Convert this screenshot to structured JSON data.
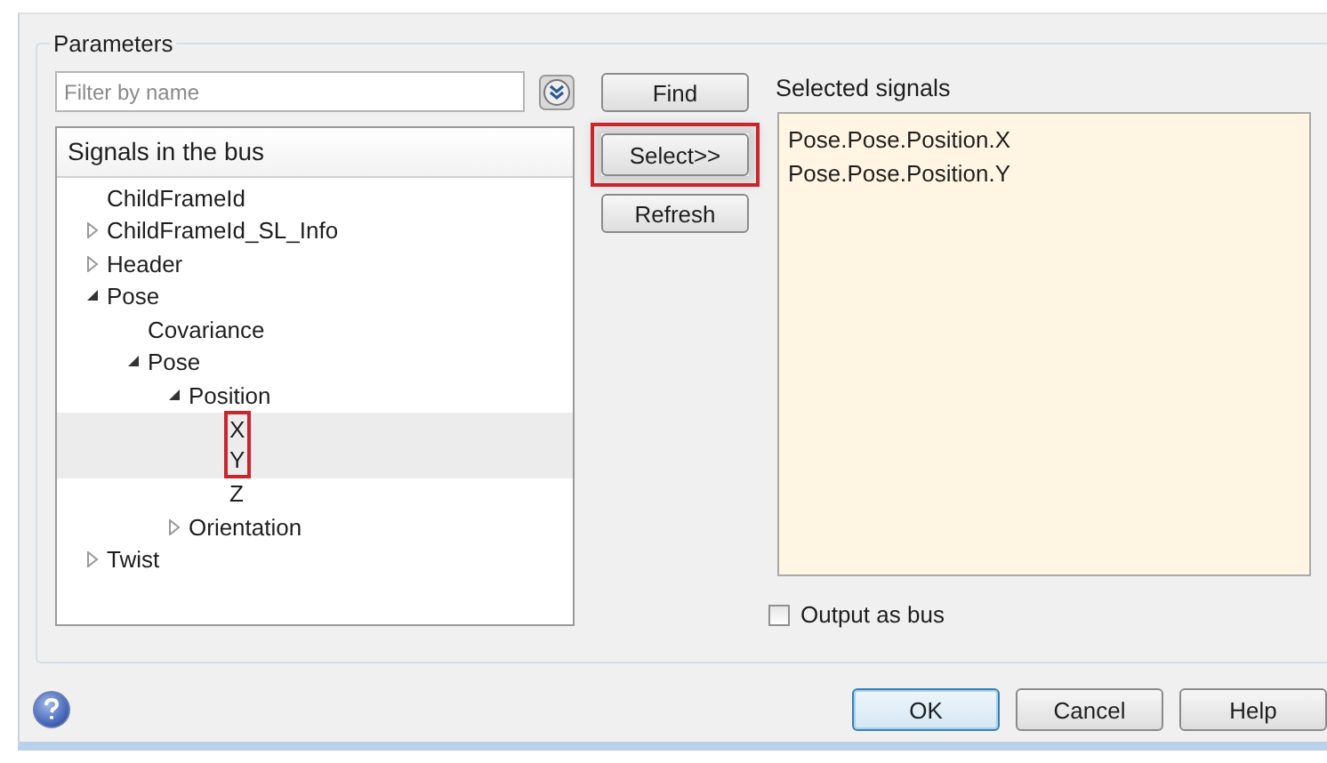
{
  "group": {
    "title": "Parameters"
  },
  "filter": {
    "placeholder": "Filter by name"
  },
  "tree": {
    "header": "Signals in the bus",
    "items": [
      {
        "label": "ChildFrameId",
        "selected": false,
        "highlighted": false
      },
      {
        "label": "ChildFrameId_SL_Info",
        "expanded": false,
        "selected": false,
        "highlighted": false
      },
      {
        "label": "Header",
        "expanded": false,
        "selected": false,
        "highlighted": false
      },
      {
        "label": "Pose",
        "expanded": true,
        "selected": false,
        "highlighted": false,
        "children": [
          {
            "label": "Covariance",
            "selected": false,
            "highlighted": false
          },
          {
            "label": "Pose",
            "expanded": true,
            "selected": false,
            "highlighted": false,
            "children": [
              {
                "label": "Position",
                "expanded": true,
                "selected": false,
                "highlighted": false,
                "children": [
                  {
                    "label": "X",
                    "selected": true,
                    "highlighted": true
                  },
                  {
                    "label": "Y",
                    "selected": true,
                    "highlighted": true
                  },
                  {
                    "label": "Z",
                    "selected": false,
                    "highlighted": false
                  }
                ]
              },
              {
                "label": "Orientation",
                "expanded": false,
                "selected": false,
                "highlighted": false
              }
            ]
          }
        ]
      },
      {
        "label": "Twist",
        "expanded": false,
        "selected": false,
        "highlighted": false
      }
    ]
  },
  "actions": [
    {
      "label": "Find",
      "highlighted": false
    },
    {
      "label": "Select>>",
      "highlighted": true
    },
    {
      "label": "Refresh",
      "highlighted": false
    }
  ],
  "selected_signals": {
    "title": "Selected signals",
    "items": [
      "Pose.Pose.Position.X",
      "Pose.Pose.Position.Y"
    ]
  },
  "output_as_bus": {
    "label": "Output as bus",
    "checked": false
  },
  "footer_buttons": [
    {
      "label": "OK",
      "default": true
    },
    {
      "label": "Cancel",
      "default": false
    },
    {
      "label": "Help",
      "default": false
    }
  ]
}
